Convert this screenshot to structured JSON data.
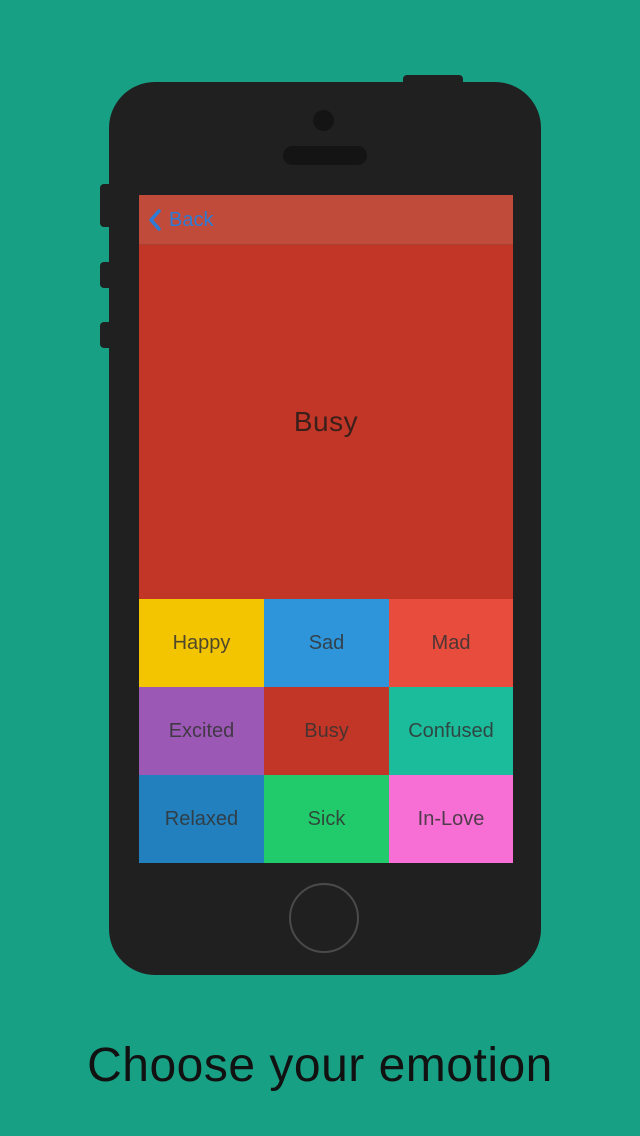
{
  "colors": {
    "background": "#18a085",
    "phone_body": "#202020",
    "phone_detail": "#141414",
    "navbar_bg": "#c04b3b",
    "back_tint": "#2e7bd6",
    "hero_bg": "#c13626"
  },
  "navbar": {
    "back_icon": "chevron-left-icon",
    "back_label": "Back"
  },
  "selected": {
    "label": "Busy"
  },
  "emotions": [
    {
      "label": "Happy",
      "color": "#f2c500"
    },
    {
      "label": "Sad",
      "color": "#2e95db"
    },
    {
      "label": "Mad",
      "color": "#e84c3d"
    },
    {
      "label": "Excited",
      "color": "#9b58b5"
    },
    {
      "label": "Busy",
      "color": "#c13626"
    },
    {
      "label": "Confused",
      "color": "#1bbc9b"
    },
    {
      "label": "Relaxed",
      "color": "#2280bf"
    },
    {
      "label": "Sick",
      "color": "#21cb6b"
    },
    {
      "label": "In-Love",
      "color": "#f76ed4"
    }
  ],
  "caption": "Choose your emotion"
}
